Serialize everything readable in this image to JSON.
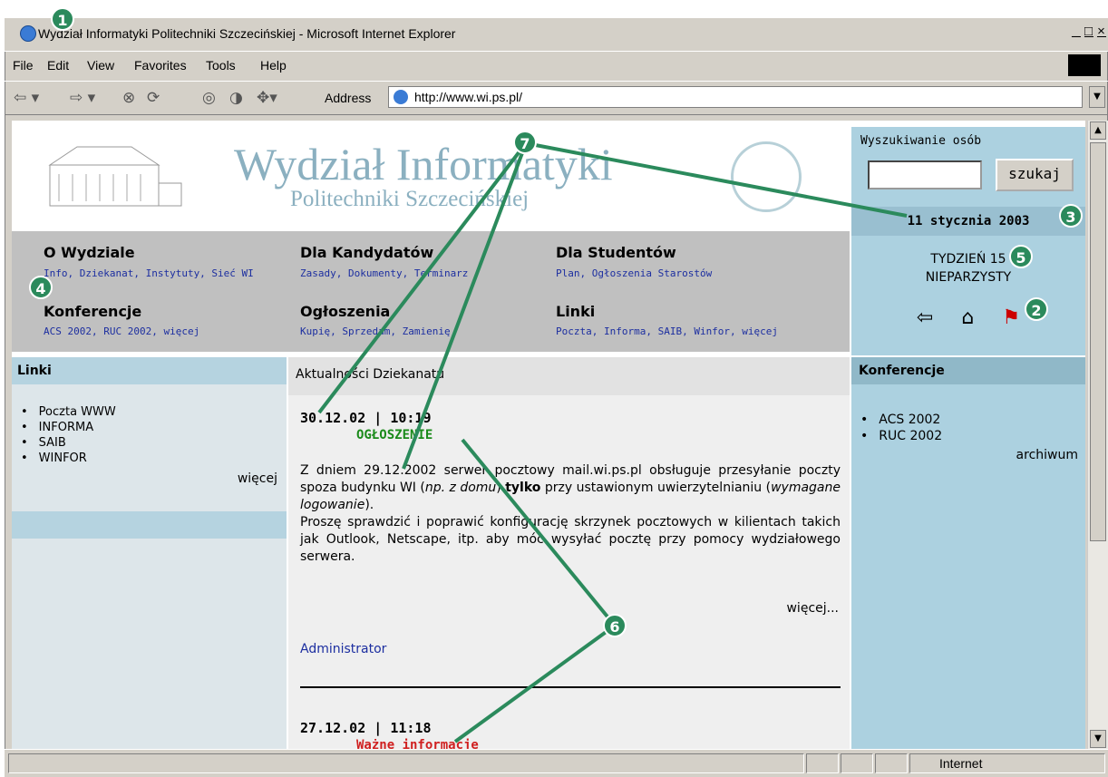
{
  "window": {
    "title": "Wydział Informatyki Politechniki Szczecińskiej - Microsoft Internet Explorer",
    "controls": [
      "_",
      "□",
      "×"
    ]
  },
  "menu": [
    "File",
    "Edit",
    "View",
    "Favorites",
    "Tools",
    "Help"
  ],
  "address": {
    "label": "Address",
    "url": "http://www.wi.ps.pl/"
  },
  "site": {
    "title": "Wydział Informatyki",
    "subtitle": "Politechniki Szczecińskiej"
  },
  "nav": {
    "o_wydziale": {
      "heading": "O Wydziale",
      "links": "Info, Dziekanat, Instytuty, Sieć WI"
    },
    "dla_kandydatow": {
      "heading": "Dla Kandydatów",
      "links": "Zasady, Dokumenty, Terminarz"
    },
    "dla_studentow": {
      "heading": "Dla Studentów",
      "links": "Plan, Ogłoszenia Starostów"
    },
    "konferencje": {
      "heading": "Konferencje",
      "links": "ACS 2002, RUC 2002, więcej"
    },
    "ogloszenia": {
      "heading": "Ogłoszenia",
      "links": "Kupię, Sprzedam, Zamienię"
    },
    "linki": {
      "heading": "Linki",
      "links": "Poczta, Informa, SAIB, Winfor, więcej"
    }
  },
  "search": {
    "title": "Wyszukiwanie osób",
    "button": "szukaj"
  },
  "date": "11 stycznia 2003",
  "week": {
    "line1": "TYDZIEŃ 15",
    "line2": "NIEPARZYSTY"
  },
  "left": {
    "heading": "Linki",
    "items": [
      "Poczta WWW",
      "INFORMA",
      "SAIB",
      "WINFOR"
    ],
    "more": "więcej"
  },
  "news": {
    "heading": "Aktualności Dziekanatu",
    "item1": {
      "date": "30.12.02 | 10:19",
      "type": "OGŁOSZENIE",
      "body1": "Z dniem 29.12.2002 serwer pocztowy mail.wi.ps.pl obsługuje przesyłanie poczty spoza budynku WI (",
      "body1_em": "np. z domu",
      "body1_b_pre": ") ",
      "body1_b": "tylko",
      "body1_post": " przy ustawionym uwierzytelnianiu (",
      "body1_em2": "wymagane logowanie",
      "body1_end": ").",
      "body2": "Proszę sprawdzić i poprawić konfigurację skrzynek pocztowych w kilientach takich jak Outlook, Netscape, itp. aby móc wysyłać pocztę przy pomocy wydziałowego serwera.",
      "more": "więcej...",
      "author": "Administrator"
    },
    "item2": {
      "date": "27.12.02 | 11:18",
      "type": "Ważne informacje"
    }
  },
  "right": {
    "heading": "Konferencje",
    "items": [
      "ACS 2002",
      "RUC 2002"
    ],
    "archive": "archiwum"
  },
  "status": {
    "zone": "Internet"
  },
  "callouts": [
    "1",
    "2",
    "3",
    "4",
    "5",
    "6",
    "7"
  ],
  "colors": {
    "accent": "#2b8a5c",
    "panel": "#acd1e0",
    "nav": "#c0c0c0",
    "link": "#1c2ea0"
  }
}
